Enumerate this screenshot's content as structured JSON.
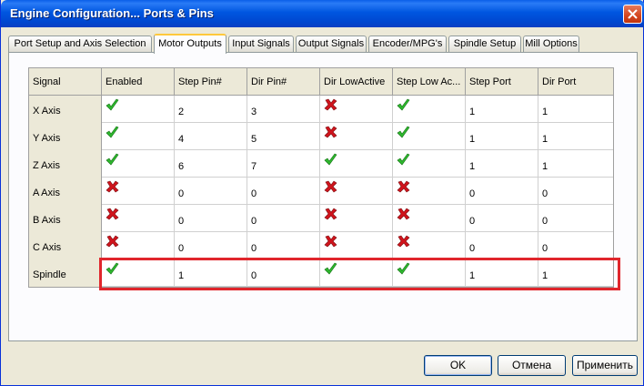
{
  "window": {
    "title": "Engine Configuration... Ports & Pins"
  },
  "tabs": [
    {
      "label": "Port Setup and Axis Selection"
    },
    {
      "label": "Motor Outputs",
      "active": true
    },
    {
      "label": "Input Signals"
    },
    {
      "label": "Output Signals"
    },
    {
      "label": "Encoder/MPG's"
    },
    {
      "label": "Spindle Setup"
    },
    {
      "label": "Mill Options"
    }
  ],
  "table": {
    "columns": [
      "Signal",
      "Enabled",
      "Step Pin#",
      "Dir Pin#",
      "Dir LowActive",
      "Step Low Ac...",
      "Step Port",
      "Dir Port"
    ],
    "rows": [
      {
        "signal": "X Axis",
        "enabled": true,
        "step_pin": "2",
        "dir_pin": "3",
        "dir_low_active": false,
        "step_low_active": true,
        "step_port": "1",
        "dir_port": "1"
      },
      {
        "signal": "Y Axis",
        "enabled": true,
        "step_pin": "4",
        "dir_pin": "5",
        "dir_low_active": false,
        "step_low_active": true,
        "step_port": "1",
        "dir_port": "1"
      },
      {
        "signal": "Z Axis",
        "enabled": true,
        "step_pin": "6",
        "dir_pin": "7",
        "dir_low_active": true,
        "step_low_active": true,
        "step_port": "1",
        "dir_port": "1"
      },
      {
        "signal": "A Axis",
        "enabled": false,
        "step_pin": "0",
        "dir_pin": "0",
        "dir_low_active": false,
        "step_low_active": false,
        "step_port": "0",
        "dir_port": "0"
      },
      {
        "signal": "B Axis",
        "enabled": false,
        "step_pin": "0",
        "dir_pin": "0",
        "dir_low_active": false,
        "step_low_active": false,
        "step_port": "0",
        "dir_port": "0"
      },
      {
        "signal": "C Axis",
        "enabled": false,
        "step_pin": "0",
        "dir_pin": "0",
        "dir_low_active": false,
        "step_low_active": false,
        "step_port": "0",
        "dir_port": "0"
      },
      {
        "signal": "Spindle",
        "enabled": true,
        "step_pin": "1",
        "dir_pin": "0",
        "dir_low_active": true,
        "step_low_active": true,
        "step_port": "1",
        "dir_port": "1"
      }
    ],
    "highlighted_row": "Spindle"
  },
  "icons": {
    "true": "green-check-icon",
    "false": "red-x-icon"
  },
  "colors": {
    "titlebar": "#0054e3",
    "highlight": "#e0262c",
    "check": "#2eb82e",
    "cross": "#d0141c"
  },
  "buttons": {
    "ok": "OK",
    "cancel": "Отмена",
    "apply": "Применить"
  }
}
